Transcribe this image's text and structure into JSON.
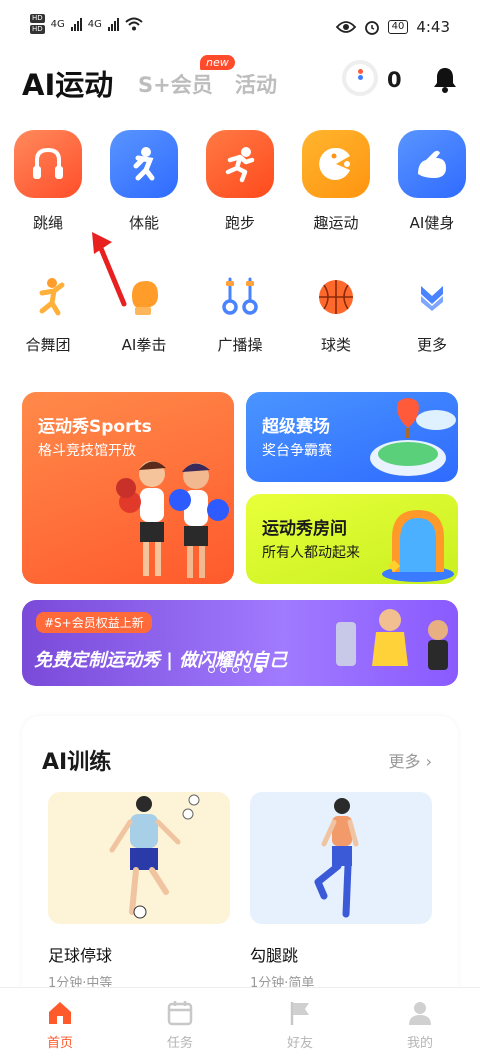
{
  "status_bar": {
    "hd1": "HD",
    "hd2": "HD",
    "net1": "4G",
    "net2": "4G",
    "battery": "40",
    "time": "4:43"
  },
  "header": {
    "title": "AI运动",
    "tab_member": "S+会员",
    "new_badge": "new",
    "tab_activity": "活动",
    "coin_count": "0"
  },
  "categories_row1": [
    {
      "label": "跳绳",
      "icon": "jump-rope-icon",
      "color": "#ff6a3d"
    },
    {
      "label": "体能",
      "icon": "fitness-icon",
      "color": "#3d7bff"
    },
    {
      "label": "跑步",
      "icon": "running-icon",
      "color": "#ff5a2c"
    },
    {
      "label": "趣运动",
      "icon": "fun-sport-icon",
      "color": "#ffa41c"
    },
    {
      "label": "AI健身",
      "icon": "arm-muscle-icon",
      "color": "#3d7bff"
    }
  ],
  "categories_row2": [
    {
      "label": "合舞团",
      "icon": "dance-icon"
    },
    {
      "label": "AI拳击",
      "icon": "boxing-glove-icon"
    },
    {
      "label": "广播操",
      "icon": "dumbbell-icon"
    },
    {
      "label": "球类",
      "icon": "basketball-icon"
    },
    {
      "label": "更多",
      "icon": "chevron-down-icon"
    }
  ],
  "banners": {
    "sports_show": {
      "title": "运动秀Sports",
      "subtitle": "格斗竞技馆开放"
    },
    "super_arena": {
      "title": "超级赛场",
      "subtitle": "奖台争霸赛"
    },
    "show_room": {
      "title": "运动秀房间",
      "subtitle": "所有人都动起来"
    },
    "member_banner": {
      "tag": "#S+会员权益上新",
      "text": "免费定制运动秀 | 做闪耀的自己"
    }
  },
  "ai_training": {
    "title": "AI训练",
    "more": "更多",
    "courses": [
      {
        "name": "足球停球",
        "meta": "1分钟·中等"
      },
      {
        "name": "勾腿跳",
        "meta": "1分钟·简单"
      }
    ]
  },
  "bottom_nav": [
    {
      "label": "首页",
      "icon": "home-icon",
      "active": true
    },
    {
      "label": "任务",
      "icon": "calendar-icon",
      "active": false
    },
    {
      "label": "好友",
      "icon": "flag-icon",
      "active": false
    },
    {
      "label": "我的",
      "icon": "profile-icon",
      "active": false
    }
  ],
  "colors": {
    "accent": "#ff5a2c",
    "blue": "#3d7bff"
  }
}
